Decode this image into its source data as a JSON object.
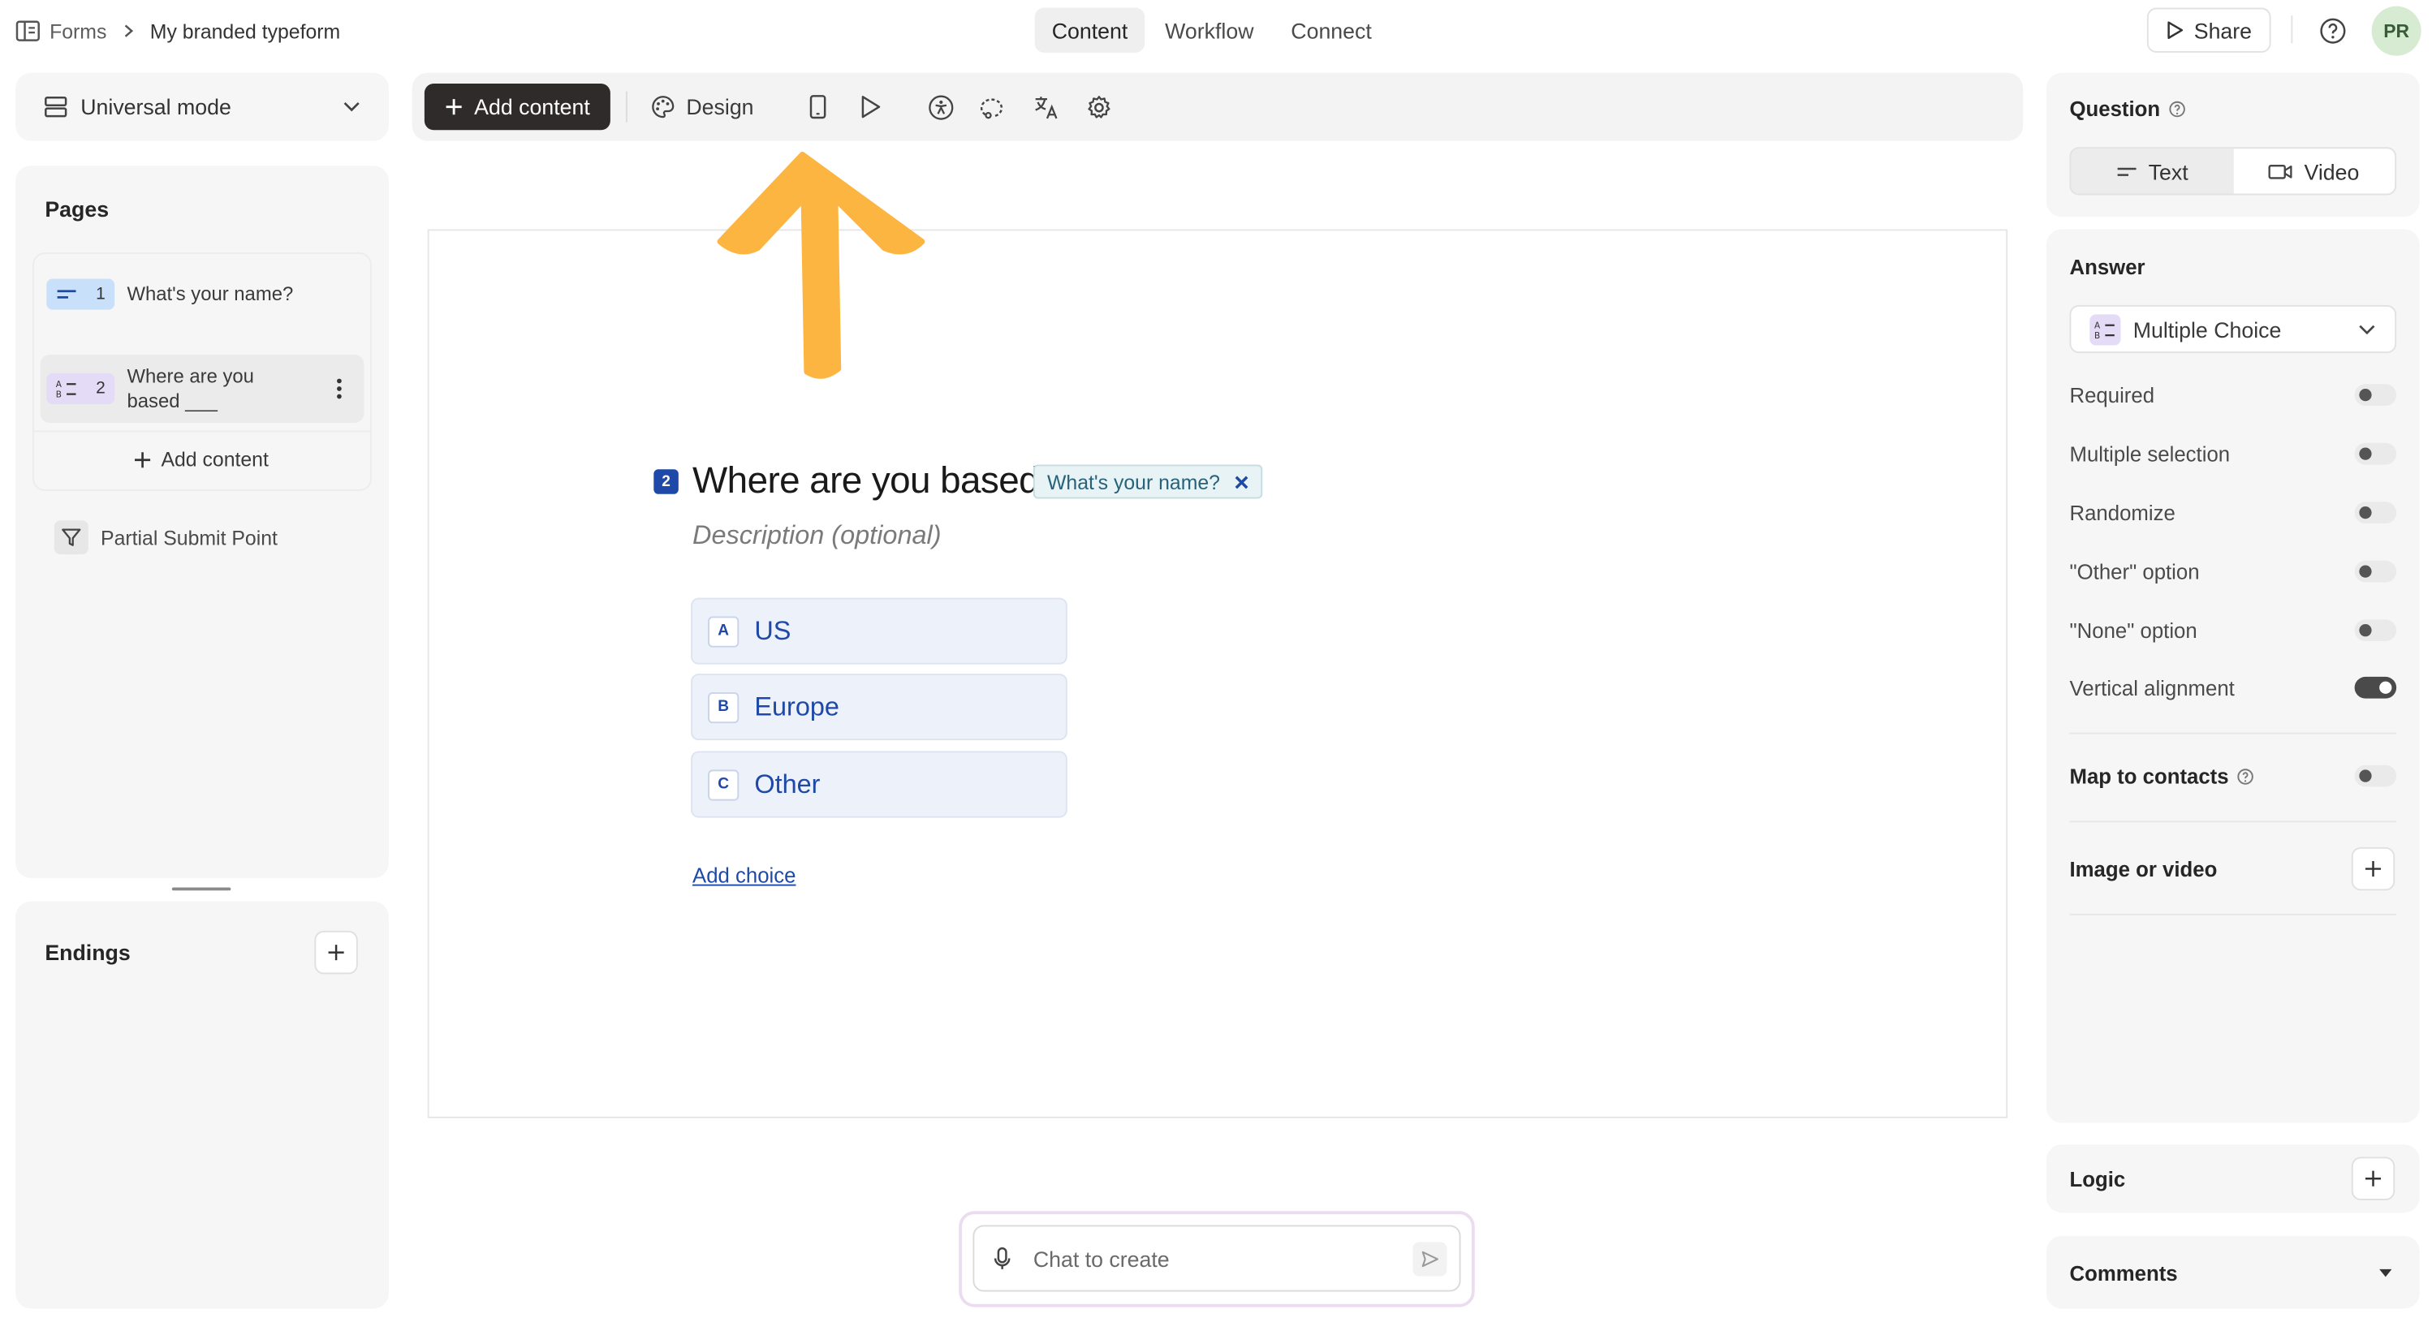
{
  "breadcrumb": {
    "root": "Forms",
    "current": "My branded typeform"
  },
  "top_tabs": [
    "Content",
    "Workflow",
    "Connect"
  ],
  "top_actions": {
    "share": "Share",
    "avatar_initials": "PR"
  },
  "left": {
    "mode_label": "Universal mode",
    "pages_title": "Pages",
    "pages": [
      {
        "number": "1",
        "label": "What's your name?",
        "type_icon": "short-text-icon"
      },
      {
        "number": "2",
        "label": "Where are you based ___",
        "type_icon": "multiple-choice-icon"
      }
    ],
    "add_content": "Add content",
    "partial_submit": "Partial Submit Point",
    "endings_title": "Endings"
  },
  "toolbar": {
    "add_content": "Add content",
    "design": "Design",
    "icons": [
      "mobile-preview-icon",
      "play-icon",
      "accessibility-icon",
      "lasso-icon",
      "translate-icon",
      "settings-icon"
    ]
  },
  "question": {
    "number": "2",
    "title": "Where are you based",
    "recall_tag": "What's your name?",
    "description_placeholder": "Description (optional)",
    "choices": [
      {
        "key": "A",
        "label": "US"
      },
      {
        "key": "B",
        "label": "Europe"
      },
      {
        "key": "C",
        "label": "Other"
      }
    ],
    "add_choice": "Add choice"
  },
  "chat": {
    "placeholder": "Chat to create"
  },
  "right": {
    "question_title": "Question",
    "question_types": [
      "Text",
      "Video"
    ],
    "answer_title": "Answer",
    "answer_type": "Multiple Choice",
    "settings": [
      {
        "label": "Required",
        "on": false
      },
      {
        "label": "Multiple selection",
        "on": false
      },
      {
        "label": "Randomize",
        "on": false
      },
      {
        "label": "\"Other\" option",
        "on": false
      },
      {
        "label": "\"None\" option",
        "on": false
      },
      {
        "label": "Vertical alignment",
        "on": true
      }
    ],
    "map_to_contacts": "Map to contacts",
    "image_or_video": "Image or video",
    "logic": "Logic",
    "comments": "Comments"
  },
  "colors": {
    "accent_blue": "#1f49a8",
    "arrow": "#fbb540",
    "dark_button": "#2f2b2b"
  }
}
